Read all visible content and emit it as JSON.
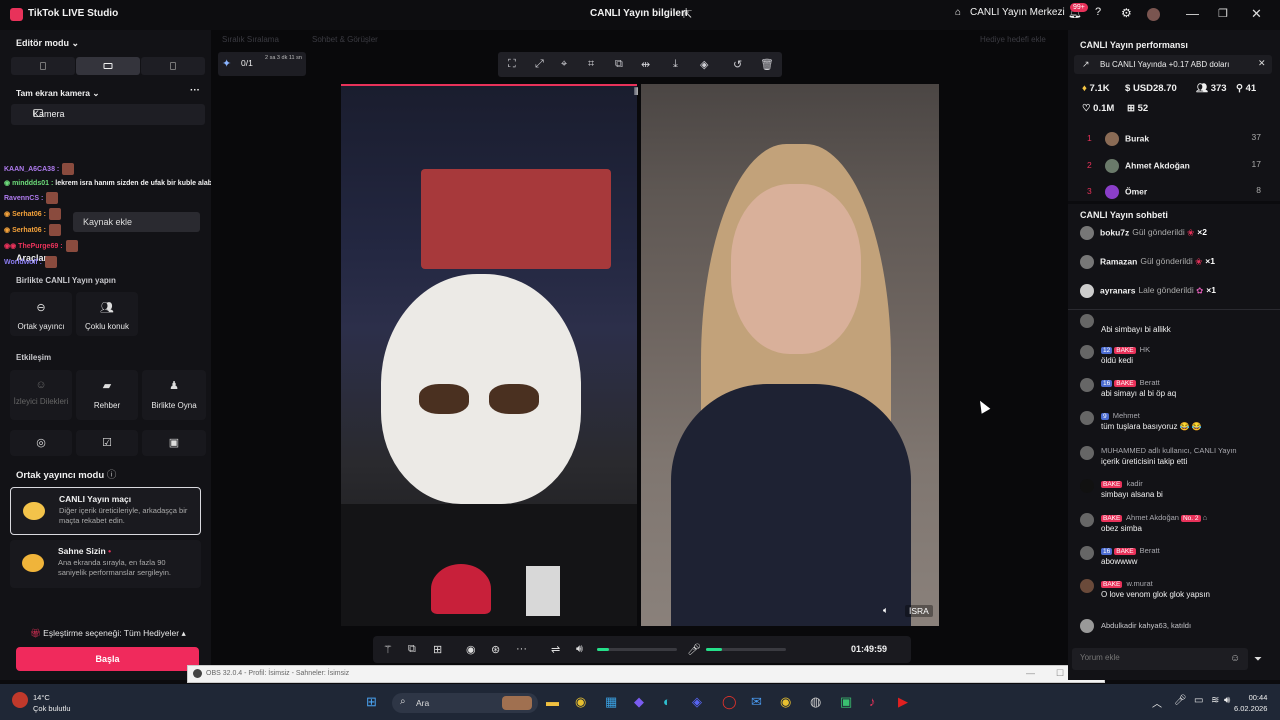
{
  "titlebar": {
    "app_name": "TikTok LIVE Studio",
    "stream_info": "CANLI Yayın bilgileri",
    "live_center": "CANLI Yayın Merkezi",
    "notif_badge": "99+"
  },
  "left": {
    "editor_mode": "Editör modu",
    "fullscreen_camera": "Tam ekran kamera",
    "camera_label": "Kamera",
    "add_source": "Kaynak ekle",
    "tools_label": "Araçlar",
    "collab_live": "Birlikte CANLI Yayın yapın",
    "cohost": "Ortak yayıncı",
    "multi_guest": "Çoklu konuk",
    "interaction": "Etkileşim",
    "viewer_requests": "İzleyici Dilekleri",
    "guide": "Rehber",
    "play_together": "Birlikte Oyna",
    "cohost_mode": "Ortak yayıncı modu",
    "modes": [
      {
        "title": "CANLI Yayın maçı",
        "desc": "Diğer içerik üreticileriyle, arkadaşça bir maçta rekabet edin."
      },
      {
        "title": "Sahne Sizin",
        "desc": "Ana ekranda sırayla, en fazla 90 saniyelik performanslar sergileyin."
      }
    ],
    "match_option": "Eşleştirme seçeneği: Tüm Hediyeler",
    "start_button": "Başla",
    "overlay_chat": [
      {
        "user": "KAAN_A6CA38",
        "text": ""
      },
      {
        "user": "minddds01",
        "text": "lekrem isra hanım sizden de ufak bir kuble alabilir miyiz"
      },
      {
        "user": "RavennCS",
        "text": ""
      },
      {
        "user": "Serhat06",
        "text": ""
      },
      {
        "user": "Serhat06",
        "text": ""
      },
      {
        "user": "ThePurge69",
        "text": ""
      },
      {
        "user": "Worldwolf",
        "text": ""
      }
    ]
  },
  "stage": {
    "ghost_left": "Sıralık Sıralama",
    "ghost_mid": "Sohbet & Görüşler",
    "ghost_right": "Hediye hedefi ekle",
    "goal_count": "0/1",
    "goal_time": "2 sa 3 dk 11 sn",
    "timer": "01:49:59",
    "guest_name": "İSRA",
    "volume_level": 0.15,
    "mic_level": 0.2
  },
  "obs": {
    "title": "OBS 32.0.4 - Profil: İsimsiz - Sahneler: İsimsiz"
  },
  "right": {
    "perf_title": "CANLI Yayın performansı",
    "earn_banner": "Bu CANLI Yayında +0.17 ABD doları",
    "stats": {
      "diamonds": "7.1K",
      "usd": "USD28.70",
      "viewers": "373",
      "new_followers": "41",
      "likes": "0.1M",
      "shares": "52"
    },
    "ranking": [
      {
        "rank": "1",
        "name": "Burak",
        "score": "37"
      },
      {
        "rank": "2",
        "name": "Ahmet Akdoğan",
        "score": "17"
      },
      {
        "rank": "3",
        "name": "Ömer",
        "score": "8"
      }
    ],
    "chat_title": "CANLI Yayın sohbeti",
    "gifts": [
      {
        "user": "boku7z",
        "action": "Gül gönderildi",
        "count": "×2"
      },
      {
        "user": "Ramazan",
        "action": "Gül gönderildi",
        "count": "×1"
      },
      {
        "user": "ayranars",
        "action": "Lale gönderildi",
        "count": "×1"
      }
    ],
    "messages": [
      {
        "header": "",
        "text": "Abi simbayı bi allikk"
      },
      {
        "header": "HK",
        "level": "12",
        "bake": "BAKE",
        "text": "öldü kedi"
      },
      {
        "header": "Beratt",
        "level": "16",
        "bake": "BAKE",
        "text": "abi simayı al bi öp aq"
      },
      {
        "header": "Mehmet",
        "level": "9",
        "text": "tüm tuşlara basıyoruz 😂 😂"
      },
      {
        "header": "MUHAMMED adlı kullanıcı, CANLI Yayın",
        "text": "içerik üreticisini takip etti"
      },
      {
        "header": "kadir",
        "bake": "BAKE",
        "text": "simbayı alsana bi"
      },
      {
        "header": "Ahmet Akdoğan",
        "bake": "BAKE",
        "no": "No. 2",
        "text": "obez simba"
      },
      {
        "header": "Beratt",
        "level": "16",
        "bake": "BAKE",
        "text": "abowwww"
      },
      {
        "header": "w.murat",
        "bake": "BAKE",
        "text": "O love venom glok glok yapsın"
      },
      {
        "header": "Abdulkadir kahya63, katıldı",
        "text": ""
      }
    ],
    "comment_placeholder": "Yorum ekle"
  },
  "taskbar": {
    "temp": "14°C",
    "weather": "Çok bulutlu",
    "search": "Ara",
    "time": "00:44",
    "date": "6.02.2026"
  },
  "colors": {
    "accent": "#e8325a",
    "green": "#25e08a",
    "panel": "#121216"
  }
}
